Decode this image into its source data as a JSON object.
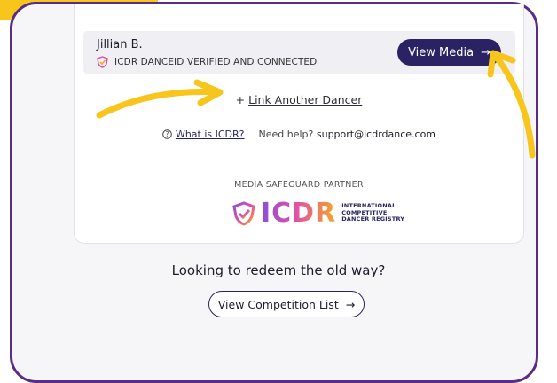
{
  "dancer": {
    "name": "Jillian B.",
    "verification": "ICDR DANCEID VERIFIED AND CONNECTED",
    "view_media_label": "View Media",
    "arrow": "→"
  },
  "link_another": {
    "prefix": "+",
    "label": "Link Another Dancer"
  },
  "help": {
    "what_is": "What is ICDR?",
    "need_help": "Need help?",
    "email": "support@icdrdance.com"
  },
  "partner": {
    "label": "MEDIA SAFEGUARD PARTNER",
    "logo_text": "ICDR",
    "logo_sub": [
      "INTERNATIONAL",
      "COMPETITIVE",
      "DANCER REGISTRY"
    ]
  },
  "redeem": {
    "text": "Looking to redeem the old way?",
    "button_label": "View Competition List",
    "arrow": "→"
  },
  "colors": {
    "brand_purple": "#5a2d82",
    "button_navy": "#2a2363",
    "accent_yellow": "#f7c51b"
  }
}
